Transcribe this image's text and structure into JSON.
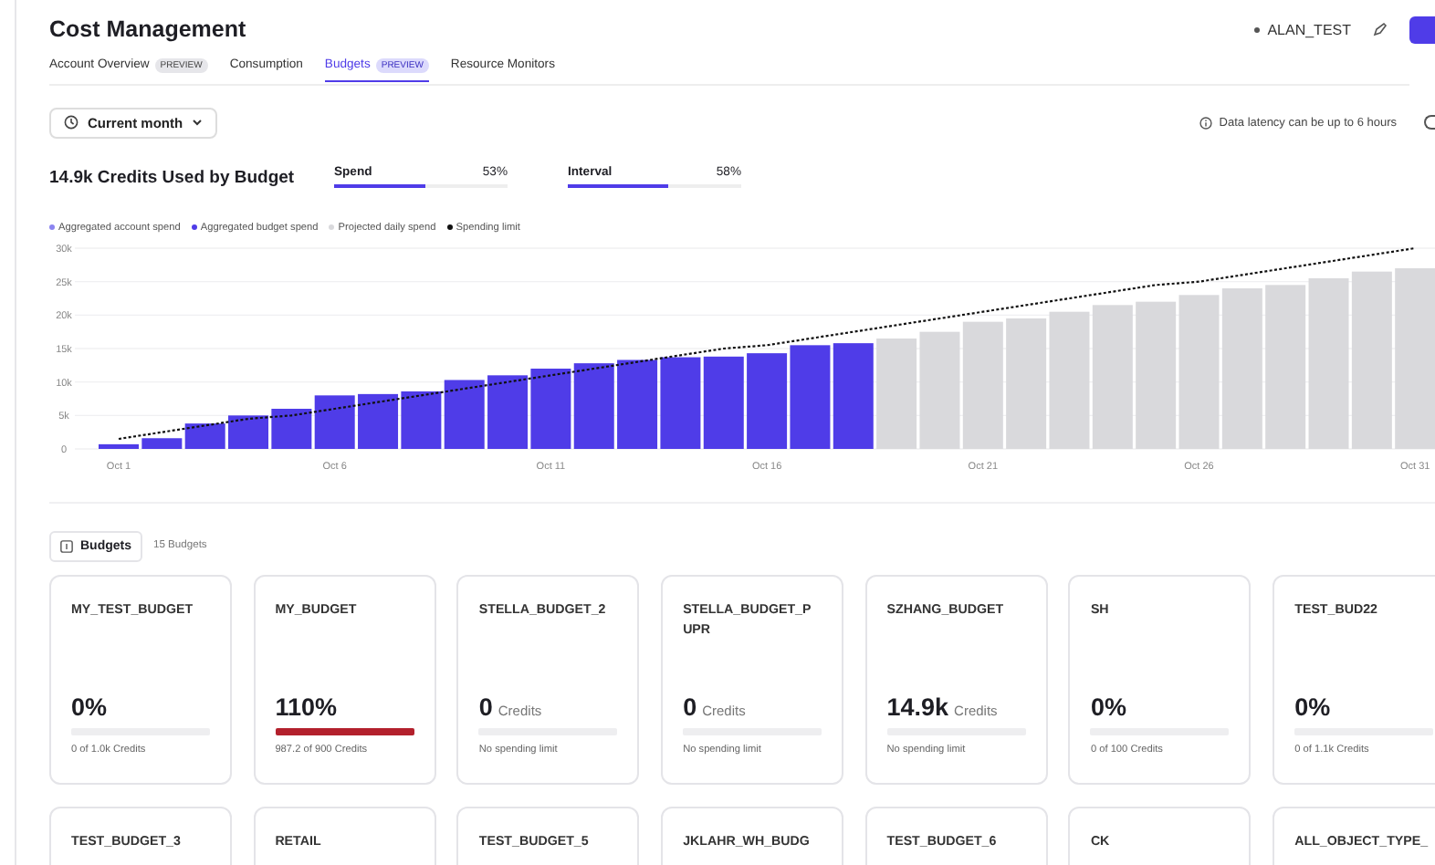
{
  "header": {
    "title": "Cost Management",
    "account": "ALAN_TEST"
  },
  "tabs": [
    {
      "label": "Account Overview",
      "badge": "PREVIEW",
      "selected": false
    },
    {
      "label": "Consumption",
      "selected": false
    },
    {
      "label": "Budgets",
      "badge": "PREVIEW",
      "selected": true
    },
    {
      "label": "Resource Monitors",
      "selected": false
    }
  ],
  "toolbar": {
    "range": "Current month",
    "note": "Data latency can be up to 6 hours"
  },
  "summary": {
    "title": "14.9k Credits Used by Budget",
    "meters": [
      {
        "label": "Spend",
        "reading": "53%",
        "level": 0.53
      },
      {
        "label": "Interval",
        "reading": "58%",
        "level": 0.58
      }
    ]
  },
  "legend": [
    {
      "label": "Aggregated account spend",
      "color": "#8b84f0"
    }
  ],
  "chart_data": {
    "type": "bar",
    "grid": true,
    "categories": [
      "Oct 1",
      null,
      null,
      null,
      null,
      "Oct 6",
      null,
      null,
      null,
      null,
      "Oct 11",
      null,
      null,
      null,
      null,
      "Oct 16",
      null,
      null,
      null,
      null,
      "Oct 21",
      null,
      null,
      null,
      null,
      "Oct 26",
      null,
      null,
      null,
      null,
      "Oct 31"
    ],
    "yticks": [
      {
        "value": 0,
        "label": "0"
      },
      {
        "value": 5000,
        "label": "5k"
      },
      {
        "value": 10000,
        "label": "10k"
      },
      {
        "value": 15000,
        "label": "15k"
      },
      {
        "value": 20000,
        "label": "20k"
      },
      {
        "value": 25000,
        "label": "25k"
      },
      {
        "value": 30000,
        "label": "30k"
      }
    ],
    "ylim": [
      0,
      30000
    ],
    "series": [
      {
        "name": "Aggregated budget spend",
        "color": "#4f3ce8",
        "values": [
          700,
          1600,
          3800,
          5000,
          6000,
          8000,
          8200,
          8600,
          10300,
          11000,
          12000,
          12800,
          13300,
          13700,
          13800,
          14300,
          15500,
          15800,
          null,
          null,
          null,
          null,
          null,
          null,
          null,
          null,
          null,
          null,
          null,
          null,
          null
        ]
      },
      {
        "name": "Projected daily spend",
        "color": "#d9d9dc",
        "values": [
          null,
          null,
          null,
          null,
          null,
          null,
          null,
          null,
          null,
          null,
          null,
          null,
          null,
          null,
          null,
          null,
          null,
          null,
          16500,
          17500,
          19000,
          19500,
          20500,
          21500,
          22000,
          23000,
          24000,
          24500,
          25500,
          26500,
          27000
        ]
      },
      {
        "name": "Spending limit",
        "type": "line",
        "line_style": "dashed",
        "color": "#111111",
        "values": [
          1500,
          2500,
          3500,
          4500,
          5000,
          6000,
          7000,
          8000,
          9000,
          10000,
          11000,
          12000,
          13000,
          14000,
          15000,
          15500,
          16500,
          17500,
          18500,
          19500,
          20500,
          21500,
          22500,
          23500,
          24500,
          25000,
          26000,
          27000,
          28000,
          29000,
          30000
        ]
      }
    ]
  },
  "budgets": {
    "title": "Budgets",
    "count": "15 Budgets",
    "cards": [
      {
        "name": "MY_TEST_BUDGET",
        "value": "0%",
        "caption": "0 of 1.0k Credits",
        "level": 0
      },
      {
        "name": "MY_BUDGET",
        "value": "110%",
        "caption": "987.2 of 900 Credits",
        "level": 1,
        "over": true
      },
      {
        "name": "STELLA_BUDGET_2",
        "value": "0",
        "unit": "Credits",
        "caption": "No spending limit",
        "level": 0
      },
      {
        "name": "STELLA_BUDGET_P UPR",
        "value": "0",
        "unit": "Credits",
        "caption": "No spending limit",
        "level": 0
      },
      {
        "name": "SZHANG_BUDGET",
        "value": "14.9k",
        "unit": "Credits",
        "caption": "No spending limit",
        "level": 0
      },
      {
        "name": "SH",
        "value": "0%",
        "caption": "0 of 100 Credits",
        "level": 0
      },
      {
        "name": "TEST_BUD22",
        "value": "0%",
        "caption": "0 of 1.1k Credits",
        "level": 0
      },
      {
        "name": "TEST_BUDGET_3"
      },
      {
        "name": "RETAIL"
      },
      {
        "name": "TEST_BUDGET_5"
      },
      {
        "name": "JKLAHR_WH_BUDG"
      },
      {
        "name": "TEST_BUDGET_6"
      },
      {
        "name": "CK"
      },
      {
        "name": "ALL_OBJECT_TYPE_"
      }
    ]
  }
}
